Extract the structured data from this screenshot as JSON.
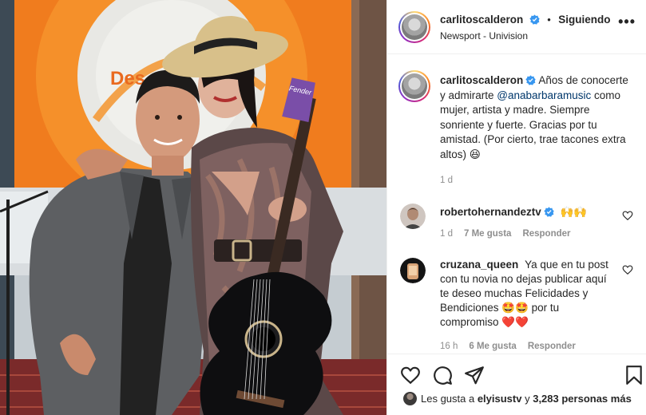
{
  "post": {
    "username": "carlitoscalderon",
    "follow_label": "Siguiendo",
    "location": "Newsport - Univision",
    "more_label": "•••",
    "separator": "•"
  },
  "caption": {
    "username": "carlitoscalderon",
    "text_1": "Años de conocerte y admirarte ",
    "mention": "@anabarbaramusic",
    "text_2": " como mujer, artista y madre. Siempre sonriente y fuerte. Gracias por tu amistad. (Por cierto, trae tacones extra altos) 😆",
    "time": "1 d"
  },
  "comments": [
    {
      "username": "robertohernandeztv",
      "text": "🙌🙌",
      "time": "1 d",
      "likes": "7 Me gusta",
      "reply": "Responder"
    },
    {
      "username": "cruzana_queen",
      "text": "Ya que en tu post con tu novia no dejas publicar aquí te deseo muchas Felicidades y Bendiciones 🤩🤩 por tu compromiso ❤️❤️",
      "time": "16 h",
      "likes": "6 Me gusta",
      "reply": "Responder"
    }
  ],
  "likes": {
    "prefix": "Les gusta a ",
    "user": "elyisustv",
    "middle": " y ",
    "count": "3,283 personas más"
  },
  "photo": {
    "backdrop_text": "Des",
    "guitar_brand": "Fender"
  },
  "icons": [
    "heart-icon",
    "comment-icon",
    "share-icon",
    "bookmark-icon",
    "verified-badge-icon",
    "more-options-icon"
  ],
  "colors": {
    "link": "#00376b",
    "verified": "#3897f0",
    "muted": "#8e8e8e",
    "text": "#262626"
  }
}
